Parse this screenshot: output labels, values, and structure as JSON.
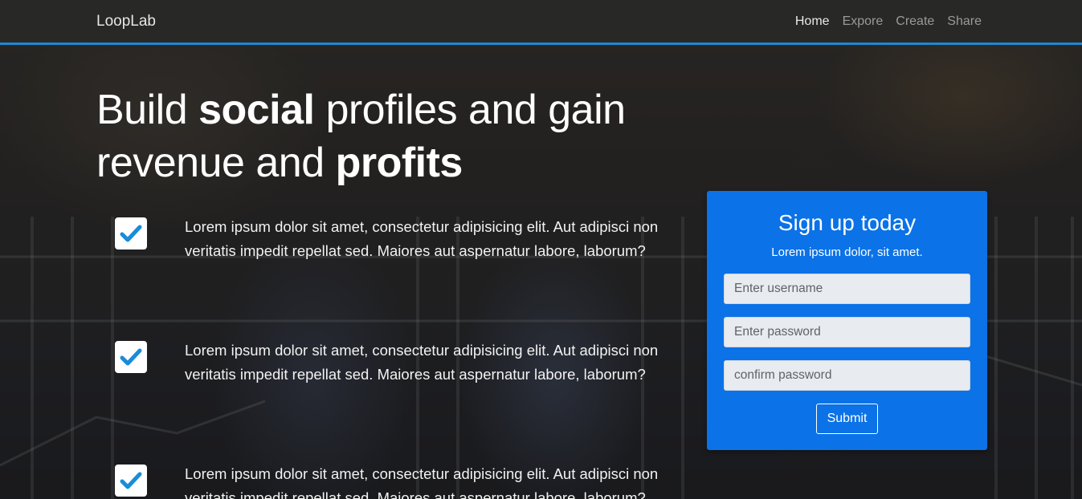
{
  "navbar": {
    "brand": "LoopLab",
    "links": [
      {
        "label": "Home",
        "active": true
      },
      {
        "label": "Expore",
        "active": false
      },
      {
        "label": "Create",
        "active": false
      },
      {
        "label": "Share",
        "active": false
      }
    ]
  },
  "hero": {
    "headline_parts": {
      "p1": "Build ",
      "b1": "social",
      "p2": " profiles and gain revenue and ",
      "b2": "profits"
    }
  },
  "features": [
    {
      "icon": "check-icon",
      "text": "Lorem ipsum dolor sit amet, consectetur adipisicing elit. Aut adipisci non veritatis impedit repellat sed. Maiores aut aspernatur labore, laborum?"
    },
    {
      "icon": "check-icon",
      "text": "Lorem ipsum dolor sit amet, consectetur adipisicing elit. Aut adipisci non veritatis impedit repellat sed. Maiores aut aspernatur labore, laborum?"
    },
    {
      "icon": "check-icon",
      "text": "Lorem ipsum dolor sit amet, consectetur adipisicing elit. Aut adipisci non veritatis impedit repellat sed. Maiores aut aspernatur labore, laborum?"
    }
  ],
  "signup": {
    "title": "Sign up today",
    "subtitle": "Lorem ipsum dolor, sit amet.",
    "username_placeholder": "Enter username",
    "password_placeholder": "Enter password",
    "confirm_placeholder": "confirm password",
    "submit_label": "Submit"
  },
  "colors": {
    "accent": "#1e88d6",
    "card": "#0b72e7",
    "check": "#1a8cd8"
  }
}
